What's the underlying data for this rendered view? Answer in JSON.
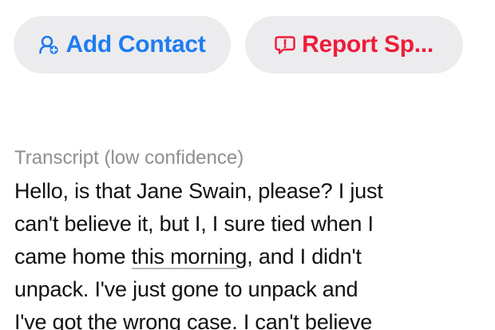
{
  "actions": {
    "add_contact": {
      "label": "Add Contact",
      "icon": "add-contact-icon",
      "color": "#1f7cf2"
    },
    "report_spam": {
      "label": "Report Sp...",
      "icon": "report-bubble-icon",
      "color": "#ee1d3a"
    },
    "pill_background": "#ececee"
  },
  "transcript": {
    "heading": "Transcript (low confidence)",
    "lines": [
      "Hello, is that Jane Swain, please? I just",
      "can't believe it, but I, I sure tied when I",
      "came home ",
      "this morning",
      ", and I didn't",
      "unpack. I've just gone to unpack and",
      "I've got the wrong case. I can't believe"
    ]
  }
}
